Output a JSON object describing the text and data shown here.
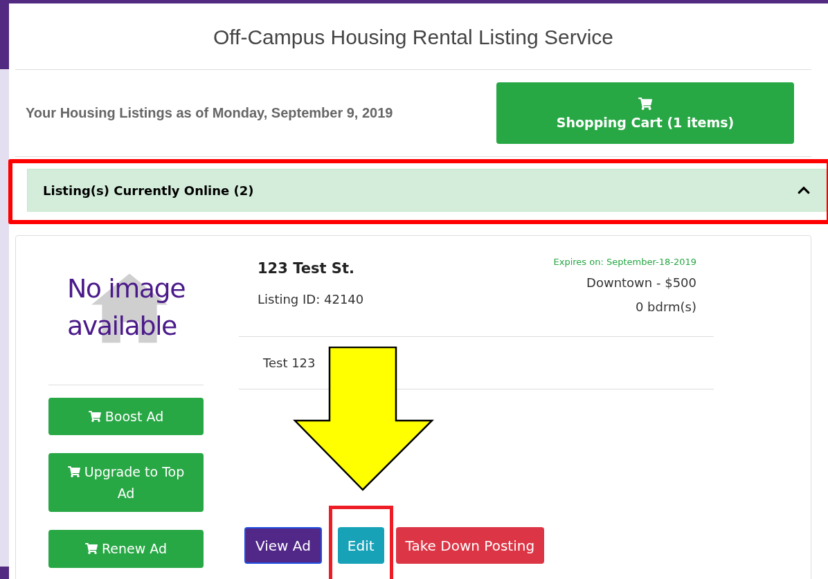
{
  "title": "Off-Campus Housing Rental Listing Service",
  "subtitle": "Your Housing Listings as of Monday, September 9, 2019",
  "cart_button": {
    "label": "Shopping Cart (1 items)"
  },
  "section": {
    "label": "Listing(s) Currently Online (2)",
    "expanded": true,
    "highlighted": true
  },
  "listing": {
    "image_placeholder": "No image\navailable",
    "address": "123 Test St.",
    "listing_id": "Listing ID: 42140",
    "expires": "Expires on: September-18-2019",
    "location_price": "Downtown - $500",
    "bedrooms": "0 bdrm(s)",
    "description": "Test 123",
    "side_buttons": [
      {
        "label": "Boost Ad"
      },
      {
        "label": "Upgrade to Top Ad"
      },
      {
        "label": "Renew Ad"
      }
    ],
    "actions": [
      {
        "label": "View Ad",
        "kind": "primary",
        "highlighted": false
      },
      {
        "label": "Edit",
        "kind": "info",
        "highlighted": true
      },
      {
        "label": "Take Down Posting",
        "kind": "danger",
        "highlighted": false
      }
    ]
  },
  "annotations": [
    {
      "kind": "arrow"
    }
  ]
}
